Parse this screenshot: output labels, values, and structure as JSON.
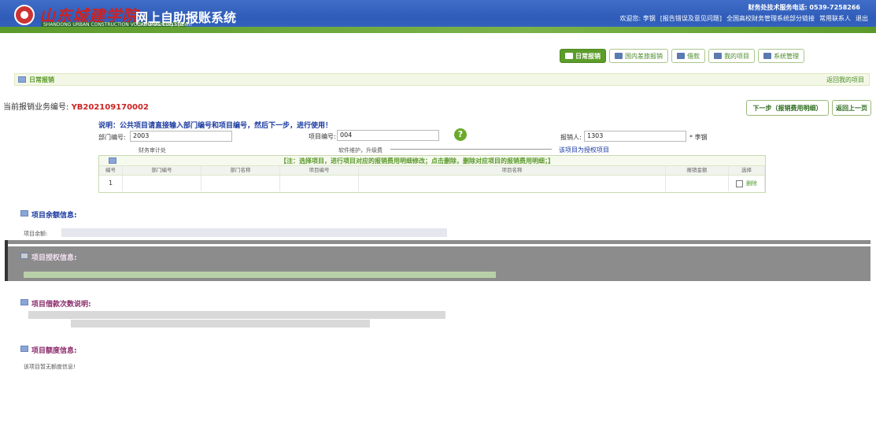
{
  "header": {
    "school_name": "山东城建学院",
    "school_en": "SHANDONG URBAN CONSTRUCTION VOCATIONAL COLLEGE",
    "system_title": "网上自助报账系统",
    "system_sub": "Online Booking System",
    "hotline": "财务处技术服务电话: 0539-7258266",
    "welcome": "欢迎您: 李钢",
    "links": [
      "[报告错误及意见问题]",
      "全国高校财务管理系统部分链接",
      "常用联系人",
      "退出"
    ]
  },
  "tabs": [
    {
      "label": "日常报销",
      "active": true,
      "icon": "doc-icon"
    },
    {
      "label": "国内差旅报销",
      "active": false,
      "icon": "key-icon"
    },
    {
      "label": "借款",
      "active": false,
      "icon": "table-icon"
    },
    {
      "label": "我的项目",
      "active": false,
      "icon": "list-icon"
    },
    {
      "label": "系统管理",
      "active": false,
      "icon": "gear-icon"
    }
  ],
  "section": {
    "title": "日常报销",
    "right_link": "返回我的项目"
  },
  "business": {
    "label": "当前报销业务编号:",
    "number": "YB202109170002"
  },
  "buttons": {
    "next": "下一步（报销费用明细）",
    "back": "返回上一页"
  },
  "note": "说明：公共项目请直接输入部门编号和项目编号，然后下一步，进行使用！",
  "form": {
    "dept_label": "部门编号:",
    "dept_value": "2003",
    "proj_label": "项目编号:",
    "proj_value": "004",
    "reimb_label": "报销人:",
    "reimb_value": "1303",
    "reimb_name": "* 李钢",
    "dept_hint": "财务审计处",
    "proj_hint": "软件维护，升级费",
    "proj_link": "该项目为授权项目"
  },
  "grid": {
    "note": "【注：选择项目，进行项目对应的报销费用明细修改；点击删除，删除对应项目的报销费用明细；】",
    "columns": [
      "编号",
      "部门编号",
      "部门名称",
      "项目编号",
      "项目名称",
      "报销金额",
      "选择"
    ],
    "row": {
      "index": "1",
      "delete": "删除"
    }
  },
  "balance": {
    "title": "项目余额信息:",
    "line_prefix": "项目余额:"
  },
  "auth": {
    "title": "项目授权信息:"
  },
  "loan": {
    "title": "项目借款次数说明:"
  },
  "quota": {
    "title": "项目额度信息:",
    "text": "该项目暂无额度信息!"
  }
}
